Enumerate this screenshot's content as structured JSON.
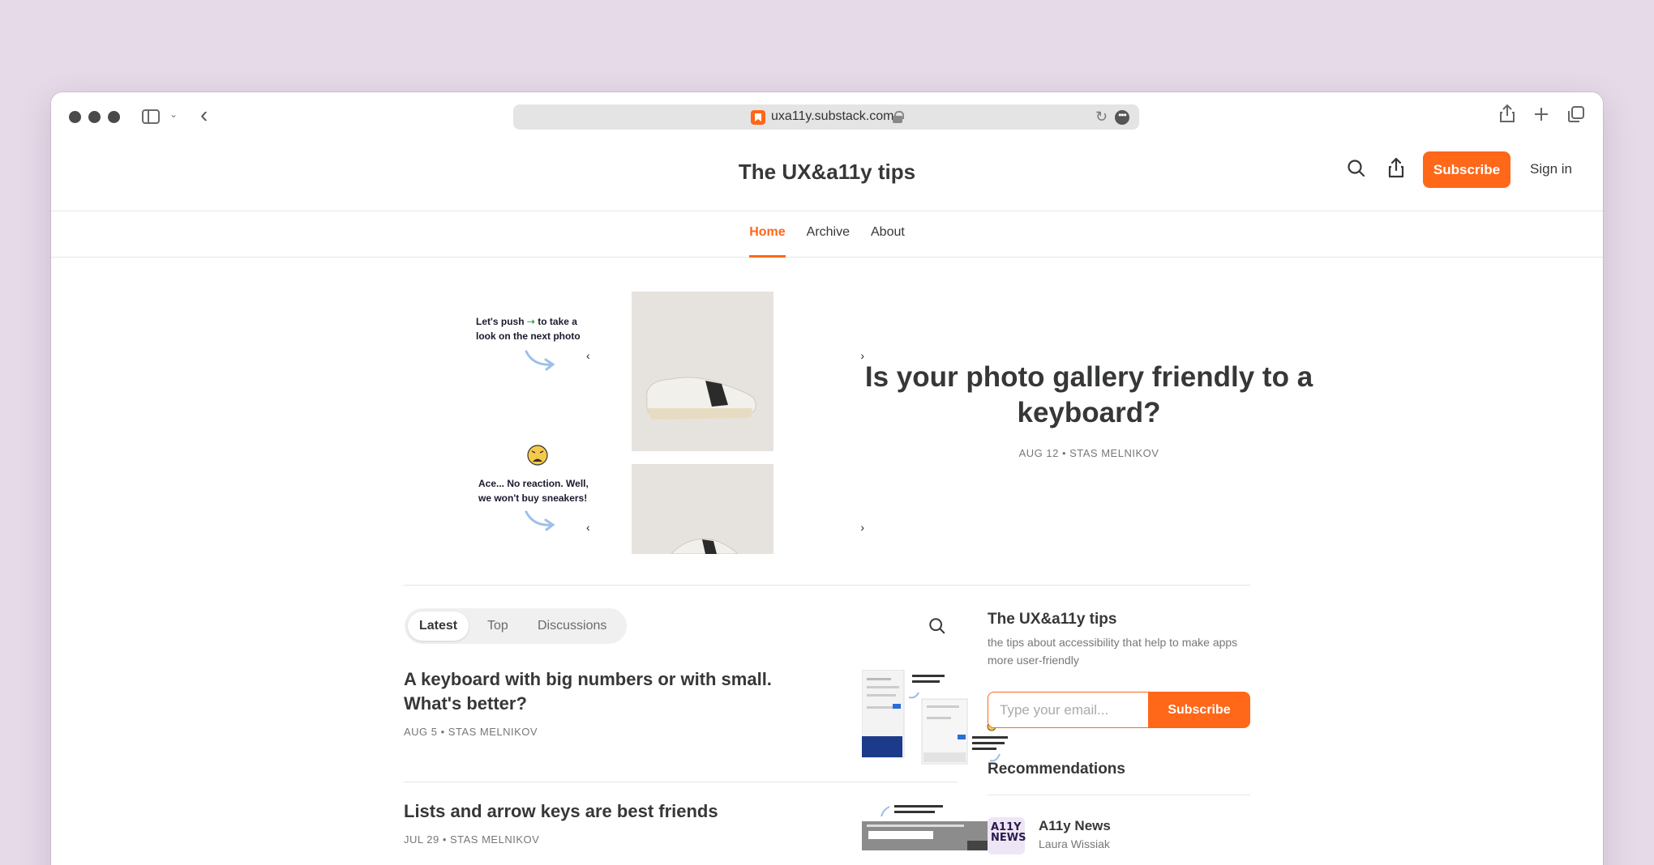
{
  "browser": {
    "url": "uxa11y.substack.com"
  },
  "site": {
    "title": "The UX&a11y tips",
    "subscribe_label": "Subscribe",
    "signin_label": "Sign in"
  },
  "nav": {
    "items": [
      {
        "label": "Home",
        "active": true
      },
      {
        "label": "Archive",
        "active": false
      },
      {
        "label": "About",
        "active": false
      }
    ]
  },
  "hero": {
    "title": "Is your photo gallery friendly to a keyboard?",
    "meta": "AUG 12 • STAS MELNIKOV",
    "image": {
      "caption_top": [
        "Let's push",
        "to take a",
        "look on the next photo"
      ],
      "caption_bottom": [
        "Ace... No reaction. Well,",
        "we won't buy sneakers!"
      ],
      "arrow_left": "‹",
      "arrow_right": "›"
    }
  },
  "tabs": [
    {
      "label": "Latest",
      "active": true
    },
    {
      "label": "Top",
      "active": false
    },
    {
      "label": "Discussions",
      "active": false
    }
  ],
  "posts": [
    {
      "title": "A keyboard with big numbers or with small. What's better?",
      "meta": "AUG 5 • STAS MELNIKOV"
    },
    {
      "title": "Lists and arrow keys are best friends",
      "meta": "JUL 29 • STAS MELNIKOV"
    }
  ],
  "sidebar": {
    "title": "The UX&a11y tips",
    "description": "the tips about accessibility that help to make apps more user-friendly",
    "email_placeholder": "Type your email...",
    "subscribe_label": "Subscribe",
    "recommendations_title": "Recommendations",
    "recommendations": [
      {
        "name": "A11y News",
        "author": "Laura Wissiak",
        "logo_text": "A11Y NEWS"
      }
    ]
  },
  "colors": {
    "accent": "#ff6719",
    "background": "#e6dae8",
    "text": "#363737",
    "muted": "#777777"
  }
}
